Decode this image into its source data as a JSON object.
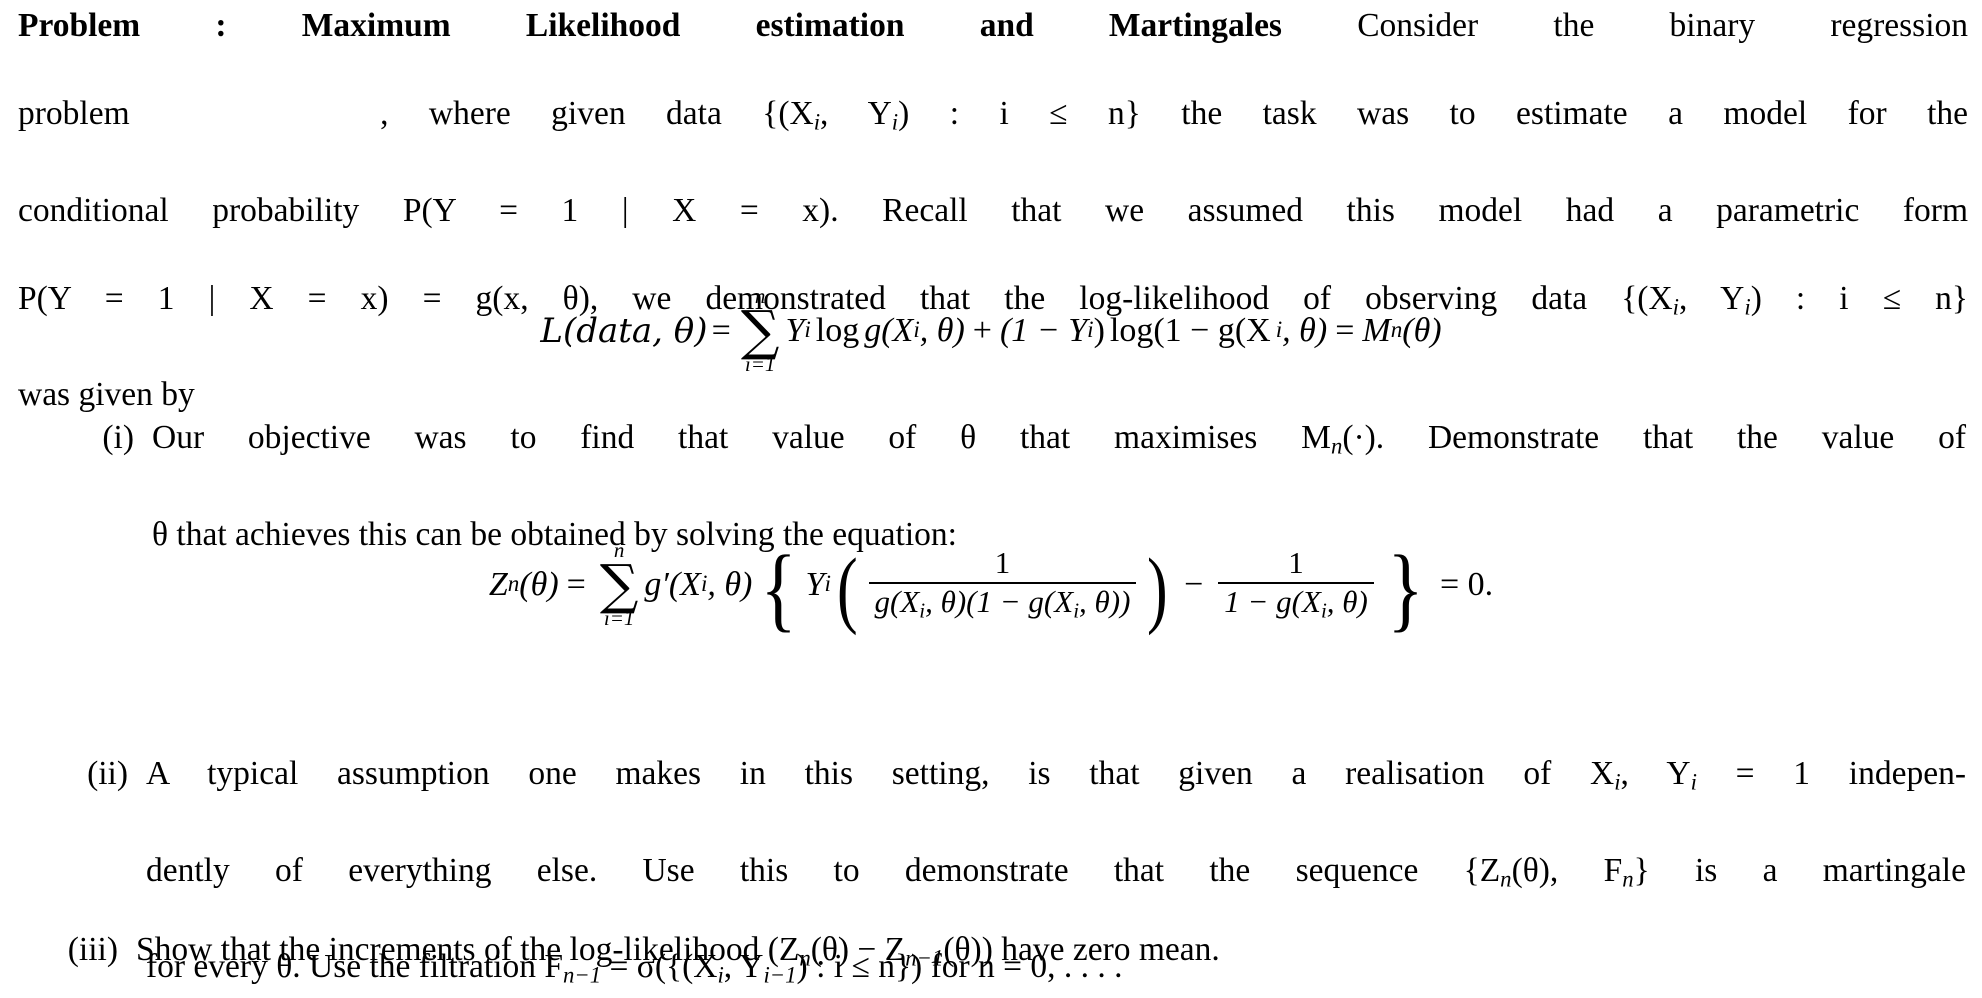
{
  "document": {
    "heading_bold": "Problem   :  Maximum Likelihood estimation and Martingales",
    "intro": {
      "line1_tail": "Consider the binary regression",
      "line2_a": "problem",
      "line2_b": ", where given data {(X",
      "line2_sub1": "i",
      "line2_c": ", Y",
      "line2_sub2": "i",
      "line2_d": ") : i ≤ n} the task was to estimate a model for the",
      "line3": "conditional probability P(Y = 1 | X = x).  Recall that we assumed this model had a parametric form",
      "line4": "P(Y = 1 | X = x) = g(x, θ), we demonstrated that the log-likelihood of observing data {(X",
      "line4_tail": ", Y",
      "line4_end": ") : i ≤ n}",
      "line5": "was given by"
    },
    "equation1": {
      "lhs": "L(data, θ)",
      "equals": "=",
      "sum_upper": "n",
      "sum_lower": "i=1",
      "sum_symbol": "∑",
      "term1": "Y",
      "term1_sub": "i",
      "log1": "log",
      "g1": "g(X",
      "g1_sub": "i",
      "g1_tail": ", θ)",
      "plus": "+",
      "term2": "(1 − Y",
      "term2_sub": "i",
      "term2_tail": ")",
      "log2": "log(1 − g(X",
      "log2_sub": "i",
      "log2_tail": ", θ)",
      "equals2": "=",
      "rhs": "M",
      "rhs_sub": "n",
      "rhs_tail": "(θ)"
    },
    "items": [
      {
        "label": "(i)",
        "line1": "Our objective was to find that value of θ that maximises M",
        "line1_sub": "n",
        "line1_tail": "(·).  Demonstrate that the value of",
        "line2": "θ that achieves this can be obtained by solving the equation:"
      },
      {
        "label": "(ii)",
        "line1": "A typical assumption one makes in this setting, is that given a realisation of X",
        "line1_sub": "i",
        "line1_mid": ", Y",
        "line1_sub2": "i",
        "line1_tail": " = 1 indepen-",
        "line2": "dently of everything else.  Use this to demonstrate that the sequence {Z",
        "line2_sub": "n",
        "line2_mid": "(θ), F",
        "line2_sub2": "n",
        "line2_tail": "} is a martingale",
        "line3": "for every θ.  Use the filtration F",
        "line3_sub": "n−1",
        "line3_mid": " = σ({(X",
        "line3_sub2": "i",
        "line3_mid2": ", Y",
        "line3_sub3": "i−1",
        "line3_tail": ") : i ≤ n}) for n = 0, . . . ."
      },
      {
        "label": "(iii)",
        "line1": "Show that the increments of the log-likelihood (Z",
        "line1_sub": "n",
        "line1_mid": "(θ) − Z",
        "line1_sub2": "n−1",
        "line1_tail": "(θ)) have zero mean."
      }
    ],
    "equation2": {
      "lhs": "Z",
      "lhs_sub": "n",
      "lhs_tail": "(θ)",
      "equals": "=",
      "sum_upper": "n",
      "sum_lower": "i=1",
      "sum_symbol": "∑",
      "gprime": "g′(X",
      "gprime_sub": "i",
      "gprime_tail": ", θ)",
      "brace_open": "{",
      "Y": "Y",
      "Y_sub": "i",
      "paren_open": "(",
      "frac1_num": "1",
      "frac1_den": "g(X",
      "frac1_den_sub": "i",
      "frac1_den_tail": ", θ)(1 − g(X",
      "frac1_den_sub2": "i",
      "frac1_den_end": ", θ))",
      "paren_close": ")",
      "minus": "−",
      "frac2_num": "1",
      "frac2_den": "1 − g(X",
      "frac2_den_sub": "i",
      "frac2_den_tail": ", θ)",
      "brace_close": "}",
      "equals2": "= 0."
    },
    "colors": {
      "text": "#000000",
      "background": "#ffffff"
    }
  }
}
